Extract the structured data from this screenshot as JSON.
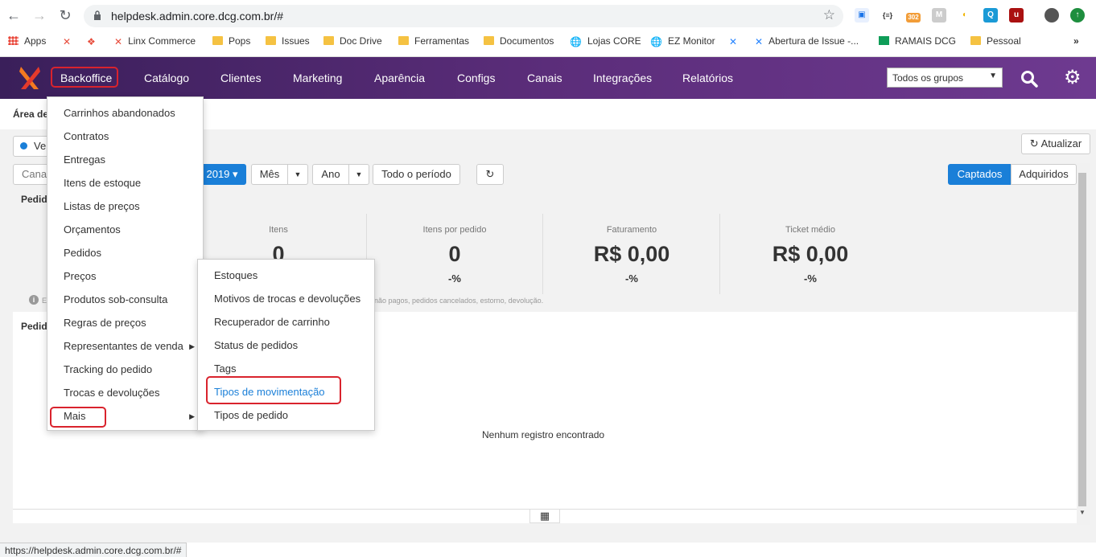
{
  "browser": {
    "url": "helpdesk.admin.core.dcg.com.br/#",
    "extensions": [
      "{≡}",
      "302"
    ],
    "bookmarks": [
      "Apps",
      "Linx Commerce",
      "Pops",
      "Issues",
      "Doc Drive",
      "Ferramentas",
      "Documentos",
      "Lojas CORE",
      "EZ Monitor",
      "Abertura de Issue -...",
      "RAMAIS DCG",
      "Pessoal"
    ],
    "bookmarks_more": "»"
  },
  "appnav": {
    "items": [
      "Backoffice",
      "Catálogo",
      "Clientes",
      "Marketing",
      "Aparência",
      "Configs",
      "Canais",
      "Integrações",
      "Relatórios"
    ],
    "group_select": "Todos os grupos"
  },
  "page": {
    "area_title": "Área de",
    "toggle_label": "Ve",
    "channel_label": "Canal",
    "date_year": "2019",
    "period_buttons": [
      "Mês",
      "Ano",
      "Todo o período"
    ],
    "refresh_label": "Atualizar",
    "tab_captados": "Captados",
    "tab_adquiridos": "Adquiridos",
    "section1": "Pedid",
    "section2": "Pedid",
    "info_prefix": "E",
    "info_text": "s não pagos, pedidos cancelados, estorno, devolução.",
    "empty_text": "Nenhum registro encontrado"
  },
  "stats": [
    {
      "label": "Itens",
      "value": "0",
      "pct": ""
    },
    {
      "label": "Itens por pedido",
      "value": "0",
      "pct": "-%"
    },
    {
      "label": "Faturamento",
      "value": "R$ 0,00",
      "pct": "-%"
    },
    {
      "label": "Ticket médio",
      "value": "R$ 0,00",
      "pct": "-%"
    }
  ],
  "backoffice_menu": [
    "Carrinhos abandonados",
    "Contratos",
    "Entregas",
    "Itens de estoque",
    "Listas de preços",
    "Orçamentos",
    "Pedidos",
    "Preços",
    "Produtos sob-consulta",
    "Regras de preços",
    "Representantes de venda",
    "Tracking do pedido",
    "Trocas e devoluções",
    "Mais"
  ],
  "mais_menu": [
    "Estoques",
    "Motivos de trocas e devoluções",
    "Recuperador de carrinho",
    "Status de pedidos",
    "Tags",
    "Tipos de movimentação",
    "Tipos de pedido"
  ],
  "status_url": "https://helpdesk.admin.core.dcg.com.br/#",
  "colors": {
    "accent": "#1a7fd8",
    "highlight": "#d9232d",
    "header": "#5b2d7a"
  }
}
